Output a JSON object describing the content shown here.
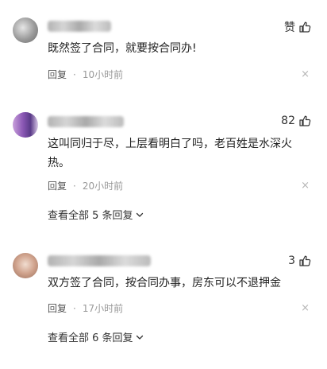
{
  "comments": [
    {
      "username": "",
      "like_label": "赞",
      "text": "既然签了合同，就要按合同办!",
      "reply_label": "回复",
      "time": "10小时前",
      "close": "×"
    },
    {
      "username": "",
      "like_label": "82",
      "text": "这叫同归于尽，上层看明白了吗，老百姓是水深火热。",
      "reply_label": "回复",
      "time": "20小时前",
      "close": "×",
      "more_label": "查看全部 5 条回复"
    },
    {
      "username": "",
      "like_label": "3",
      "text": "双方签了合同，按合同办事，房东可以不退押金",
      "reply_label": "回复",
      "time": "17小时前",
      "close": "×",
      "more_label": "查看全部 6 条回复"
    }
  ],
  "icons": {
    "like": "thumbs-up-icon",
    "close": "close-icon",
    "expand": "chevron-down-icon"
  }
}
